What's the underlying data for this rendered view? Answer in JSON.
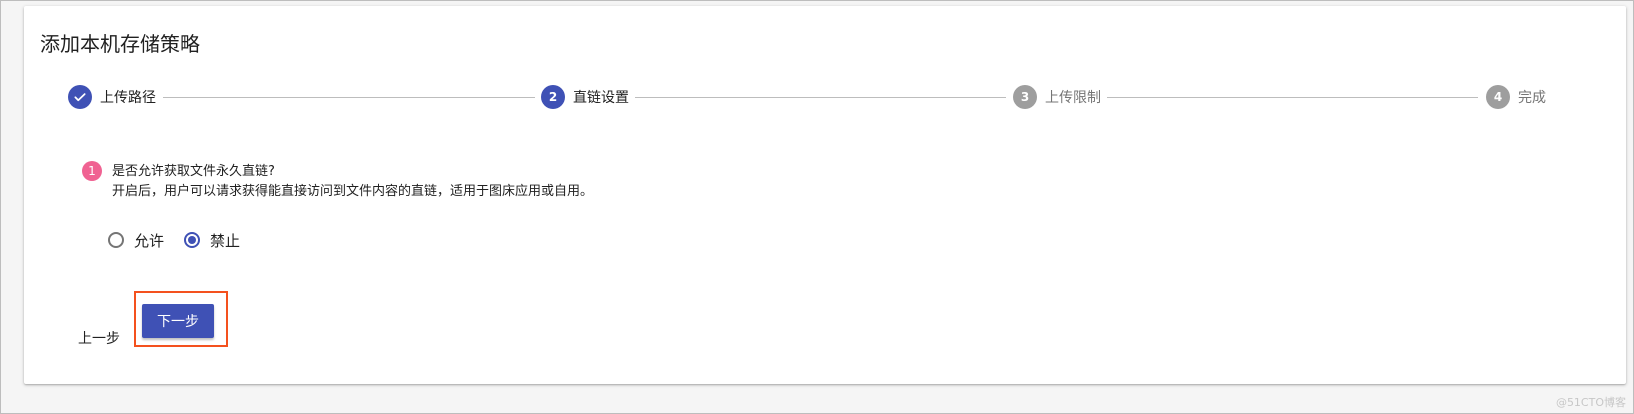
{
  "page_title": "添加本机存储策略",
  "stepper": {
    "steps": [
      {
        "label": "上传路径",
        "number": "",
        "status": "completed",
        "icon": "check-icon"
      },
      {
        "label": "直链设置",
        "number": "2",
        "status": "active"
      },
      {
        "label": "上传限制",
        "number": "3",
        "status": "inactive"
      },
      {
        "label": "完成",
        "number": "4",
        "status": "inactive"
      }
    ]
  },
  "question": {
    "number": "1",
    "title": "是否允许获取文件永久直链?",
    "description": "开启后，用户可以请求获得能直接访问到文件内容的直链，适用于图床应用或自用。"
  },
  "options": [
    {
      "label": "允许",
      "checked": false
    },
    {
      "label": "禁止",
      "checked": true
    }
  ],
  "actions": {
    "prev_label": "上一步",
    "next_label": "下一步"
  },
  "watermark": "@51CTO博客",
  "colors": {
    "primary": "#3f51b5",
    "inactive": "#9e9e9e",
    "badge": "#f06292",
    "highlight": "#f4511e"
  }
}
